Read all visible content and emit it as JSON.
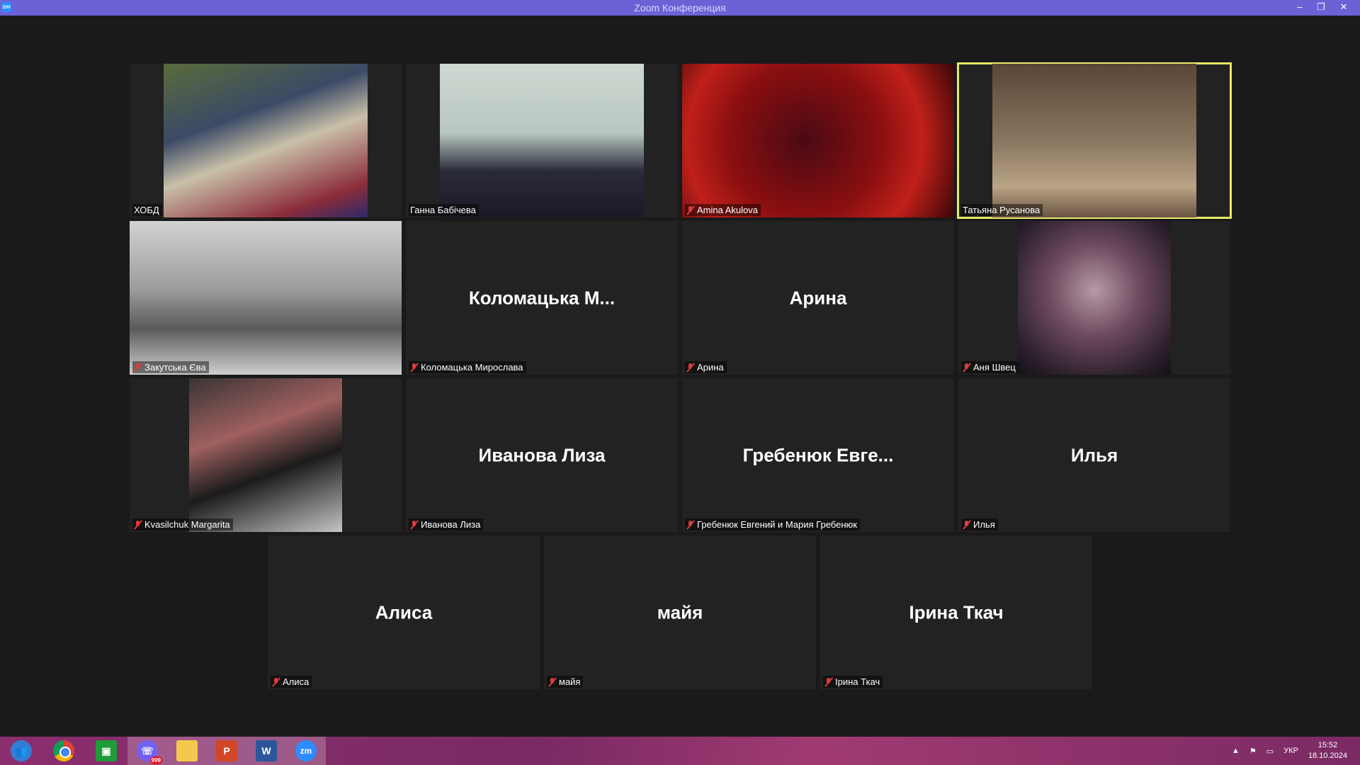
{
  "window": {
    "title": "Zoom Конференция",
    "app_icon": "zm",
    "controls": {
      "minimize": "–",
      "maximize": "❐",
      "close": "✕"
    }
  },
  "participants": [
    {
      "label": "ХОБД",
      "display": "",
      "video": true,
      "muted": false,
      "active": false
    },
    {
      "label": "Ганна Бабічева",
      "display": "",
      "video": true,
      "muted": false,
      "active": false
    },
    {
      "label": "Amina Akulova",
      "display": "",
      "video": true,
      "muted": true,
      "active": false
    },
    {
      "label": "Татьяна Русанова",
      "display": "",
      "video": true,
      "muted": false,
      "active": true
    },
    {
      "label": "Закутська Єва",
      "display": "",
      "video": true,
      "muted": true,
      "active": false
    },
    {
      "label": "Коломацька Мирослава",
      "display": "Коломацька  М...",
      "video": false,
      "muted": true,
      "active": false
    },
    {
      "label": "Арина",
      "display": "Арина",
      "video": false,
      "muted": true,
      "active": false
    },
    {
      "label": "Аня Швец",
      "display": "",
      "video": true,
      "muted": true,
      "active": false
    },
    {
      "label": "Kvasilchuk Margarita",
      "display": "",
      "video": true,
      "muted": true,
      "active": false
    },
    {
      "label": "Иванова Лиза",
      "display": "Иванова Лиза",
      "video": false,
      "muted": true,
      "active": false
    },
    {
      "label": "Гребенюк Евгений и Мария Гребенюк",
      "display": "Гребенюк  Евге...",
      "video": false,
      "muted": true,
      "active": false
    },
    {
      "label": "Илья",
      "display": "Илья",
      "video": false,
      "muted": true,
      "active": false
    },
    {
      "label": "Алиса",
      "display": "Алиса",
      "video": false,
      "muted": true,
      "active": false
    },
    {
      "label": "майя",
      "display": "майя",
      "video": false,
      "muted": true,
      "active": false
    },
    {
      "label": "Ірина Ткач",
      "display": "Ірина Ткач",
      "video": false,
      "muted": true,
      "active": false
    }
  ],
  "taskbar": {
    "apps": [
      {
        "name": "people-icon"
      },
      {
        "name": "chrome-icon"
      },
      {
        "name": "store-icon"
      },
      {
        "name": "viber-icon",
        "badge": "999"
      },
      {
        "name": "folder-icon"
      },
      {
        "name": "powerpoint-icon",
        "glyph": "P"
      },
      {
        "name": "word-icon",
        "glyph": "W"
      },
      {
        "name": "zoom-icon",
        "glyph": "zm"
      }
    ],
    "tray": {
      "lang": "УКР",
      "time": "15:52",
      "date": "18.10.2024"
    }
  },
  "colors": {
    "titlebar": "#6b62d6",
    "active_speaker_border": "#e8e86a",
    "muted_mic": "#e03b3b",
    "taskbar": "#8b2e6e"
  }
}
